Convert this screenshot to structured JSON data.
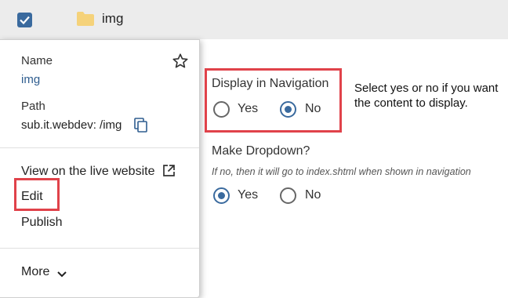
{
  "row": {
    "folder_name": "img",
    "checked": true
  },
  "context_menu": {
    "name_label": "Name",
    "name_value": "img",
    "path_label": "Path",
    "path_value": "sub.it.webdev: /img",
    "view_live": "View on the live website",
    "edit": "Edit",
    "publish": "Publish",
    "more": "More"
  },
  "form": {
    "display_in_nav": {
      "label": "Display in Navigation",
      "options": [
        {
          "label": "Yes",
          "selected": false
        },
        {
          "label": "No",
          "selected": true
        }
      ]
    },
    "make_dropdown": {
      "label": "Make Dropdown?",
      "hint": "If no, then it will go to index.shtml when shown in navigation",
      "options": [
        {
          "label": "Yes",
          "selected": true
        },
        {
          "label": "No",
          "selected": false
        }
      ]
    }
  },
  "callout": "Select yes or no if you want the content to display.",
  "colors": {
    "accent": "#3a6a9e",
    "highlight": "#e0424a",
    "folder": "#f5d27a"
  }
}
